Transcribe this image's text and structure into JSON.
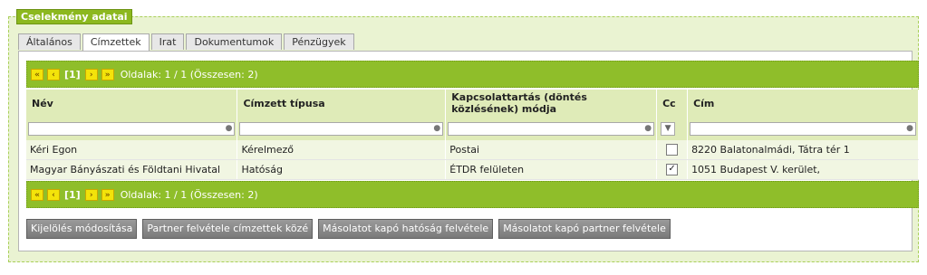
{
  "fieldset": {
    "legend": "Cselekmény adatai"
  },
  "tabs": [
    {
      "label": "Általános",
      "active": false
    },
    {
      "label": "Címzettek",
      "active": true
    },
    {
      "label": "Irat",
      "active": false
    },
    {
      "label": "Dokumentumok",
      "active": false
    },
    {
      "label": "Pénzügyek",
      "active": false
    }
  ],
  "pager": {
    "first_icon": "«",
    "prev_icon": "‹",
    "current": "[1]",
    "next_icon": "›",
    "last_icon": "»",
    "info": "Oldalak: 1 / 1 (Összesen: 2)"
  },
  "table": {
    "columns": [
      {
        "label": "Név"
      },
      {
        "label": "Címzett típusa"
      },
      {
        "label": "Kapcsolattartás (döntés közlésének) módja"
      },
      {
        "label": "Cc"
      },
      {
        "label": "Cím"
      }
    ],
    "filter_icon": "filter-icon",
    "rows": [
      {
        "nev": "Kéri Egon",
        "tipus": "Kérelmező",
        "mod": "Postai",
        "cc": "",
        "cim": "8220 Balatonalmádi, Tátra tér 1"
      },
      {
        "nev": "Magyar Bányászati és Földtani Hivatal",
        "tipus": "Hatóság",
        "mod": "ÉTDR felületen",
        "cc": "✓",
        "cim": "1051 Budapest V. kerület,"
      }
    ]
  },
  "buttons": {
    "modify": "Kijelölés módosítása",
    "add_partner": "Partner felvétele címzettek közé",
    "copy_authority": "Másolatot kapó hatóság felvétele",
    "copy_partner": "Másolatot kapó partner felvétele"
  },
  "colors": {
    "accent": "#8fbe2a",
    "header_bg": "#dfebb8",
    "panel_bg": "#eaf3d2",
    "button": "#7a7a7a"
  }
}
